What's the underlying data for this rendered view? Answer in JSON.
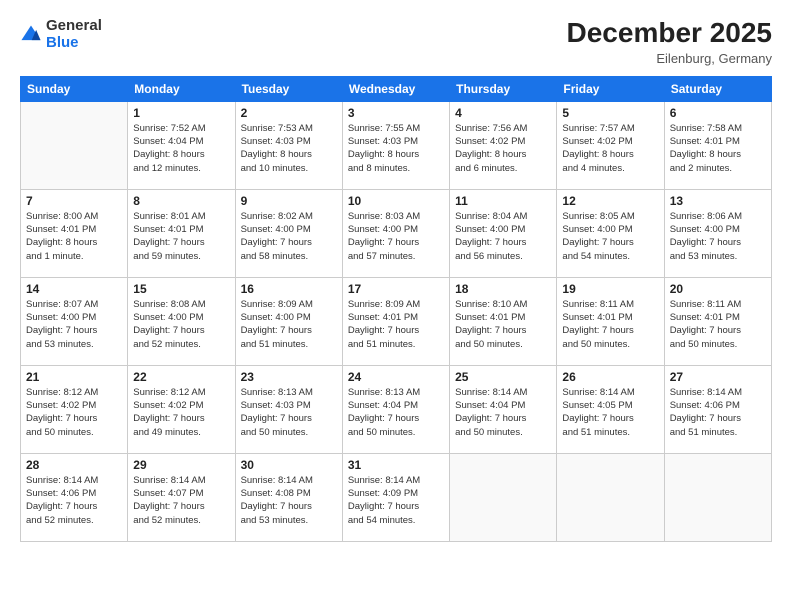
{
  "header": {
    "logo_line1": "General",
    "logo_line2": "Blue",
    "month_title": "December 2025",
    "location": "Eilenburg, Germany"
  },
  "weekdays": [
    "Sunday",
    "Monday",
    "Tuesday",
    "Wednesday",
    "Thursday",
    "Friday",
    "Saturday"
  ],
  "weeks": [
    [
      {
        "day": "",
        "info": ""
      },
      {
        "day": "1",
        "info": "Sunrise: 7:52 AM\nSunset: 4:04 PM\nDaylight: 8 hours\nand 12 minutes."
      },
      {
        "day": "2",
        "info": "Sunrise: 7:53 AM\nSunset: 4:03 PM\nDaylight: 8 hours\nand 10 minutes."
      },
      {
        "day": "3",
        "info": "Sunrise: 7:55 AM\nSunset: 4:03 PM\nDaylight: 8 hours\nand 8 minutes."
      },
      {
        "day": "4",
        "info": "Sunrise: 7:56 AM\nSunset: 4:02 PM\nDaylight: 8 hours\nand 6 minutes."
      },
      {
        "day": "5",
        "info": "Sunrise: 7:57 AM\nSunset: 4:02 PM\nDaylight: 8 hours\nand 4 minutes."
      },
      {
        "day": "6",
        "info": "Sunrise: 7:58 AM\nSunset: 4:01 PM\nDaylight: 8 hours\nand 2 minutes."
      }
    ],
    [
      {
        "day": "7",
        "info": "Sunrise: 8:00 AM\nSunset: 4:01 PM\nDaylight: 8 hours\nand 1 minute."
      },
      {
        "day": "8",
        "info": "Sunrise: 8:01 AM\nSunset: 4:01 PM\nDaylight: 7 hours\nand 59 minutes."
      },
      {
        "day": "9",
        "info": "Sunrise: 8:02 AM\nSunset: 4:00 PM\nDaylight: 7 hours\nand 58 minutes."
      },
      {
        "day": "10",
        "info": "Sunrise: 8:03 AM\nSunset: 4:00 PM\nDaylight: 7 hours\nand 57 minutes."
      },
      {
        "day": "11",
        "info": "Sunrise: 8:04 AM\nSunset: 4:00 PM\nDaylight: 7 hours\nand 56 minutes."
      },
      {
        "day": "12",
        "info": "Sunrise: 8:05 AM\nSunset: 4:00 PM\nDaylight: 7 hours\nand 54 minutes."
      },
      {
        "day": "13",
        "info": "Sunrise: 8:06 AM\nSunset: 4:00 PM\nDaylight: 7 hours\nand 53 minutes."
      }
    ],
    [
      {
        "day": "14",
        "info": "Sunrise: 8:07 AM\nSunset: 4:00 PM\nDaylight: 7 hours\nand 53 minutes."
      },
      {
        "day": "15",
        "info": "Sunrise: 8:08 AM\nSunset: 4:00 PM\nDaylight: 7 hours\nand 52 minutes."
      },
      {
        "day": "16",
        "info": "Sunrise: 8:09 AM\nSunset: 4:00 PM\nDaylight: 7 hours\nand 51 minutes."
      },
      {
        "day": "17",
        "info": "Sunrise: 8:09 AM\nSunset: 4:01 PM\nDaylight: 7 hours\nand 51 minutes."
      },
      {
        "day": "18",
        "info": "Sunrise: 8:10 AM\nSunset: 4:01 PM\nDaylight: 7 hours\nand 50 minutes."
      },
      {
        "day": "19",
        "info": "Sunrise: 8:11 AM\nSunset: 4:01 PM\nDaylight: 7 hours\nand 50 minutes."
      },
      {
        "day": "20",
        "info": "Sunrise: 8:11 AM\nSunset: 4:01 PM\nDaylight: 7 hours\nand 50 minutes."
      }
    ],
    [
      {
        "day": "21",
        "info": "Sunrise: 8:12 AM\nSunset: 4:02 PM\nDaylight: 7 hours\nand 50 minutes."
      },
      {
        "day": "22",
        "info": "Sunrise: 8:12 AM\nSunset: 4:02 PM\nDaylight: 7 hours\nand 49 minutes."
      },
      {
        "day": "23",
        "info": "Sunrise: 8:13 AM\nSunset: 4:03 PM\nDaylight: 7 hours\nand 50 minutes."
      },
      {
        "day": "24",
        "info": "Sunrise: 8:13 AM\nSunset: 4:04 PM\nDaylight: 7 hours\nand 50 minutes."
      },
      {
        "day": "25",
        "info": "Sunrise: 8:14 AM\nSunset: 4:04 PM\nDaylight: 7 hours\nand 50 minutes."
      },
      {
        "day": "26",
        "info": "Sunrise: 8:14 AM\nSunset: 4:05 PM\nDaylight: 7 hours\nand 51 minutes."
      },
      {
        "day": "27",
        "info": "Sunrise: 8:14 AM\nSunset: 4:06 PM\nDaylight: 7 hours\nand 51 minutes."
      }
    ],
    [
      {
        "day": "28",
        "info": "Sunrise: 8:14 AM\nSunset: 4:06 PM\nDaylight: 7 hours\nand 52 minutes."
      },
      {
        "day": "29",
        "info": "Sunrise: 8:14 AM\nSunset: 4:07 PM\nDaylight: 7 hours\nand 52 minutes."
      },
      {
        "day": "30",
        "info": "Sunrise: 8:14 AM\nSunset: 4:08 PM\nDaylight: 7 hours\nand 53 minutes."
      },
      {
        "day": "31",
        "info": "Sunrise: 8:14 AM\nSunset: 4:09 PM\nDaylight: 7 hours\nand 54 minutes."
      },
      {
        "day": "",
        "info": ""
      },
      {
        "day": "",
        "info": ""
      },
      {
        "day": "",
        "info": ""
      }
    ]
  ]
}
